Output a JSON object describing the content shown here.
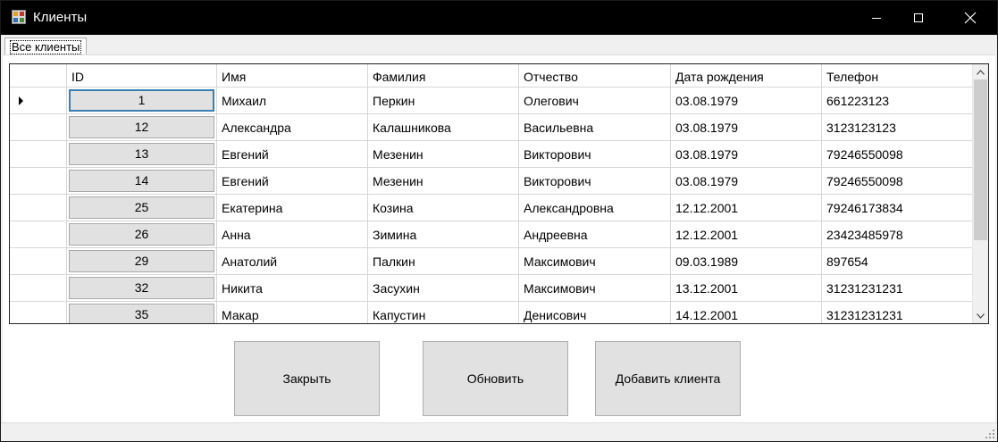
{
  "window": {
    "title": "Клиенты",
    "icon": "app-form-icon",
    "controls": [
      "minimize-icon",
      "maximize-icon",
      "close-icon"
    ]
  },
  "tab": {
    "label": "Все клиенты"
  },
  "table": {
    "columns": [
      "ID",
      "Имя",
      "Фамилия",
      "Отчество",
      "Дата рождения",
      "Телефон"
    ],
    "selected_row": 0,
    "rows": [
      {
        "id": "1",
        "first": "Михаил",
        "last": "Перкин",
        "middle": "Олегович",
        "birth": "03.08.1979",
        "phone": "661223123"
      },
      {
        "id": "12",
        "first": "Александра",
        "last": "Калашникова",
        "middle": "Васильевна",
        "birth": "03.08.1979",
        "phone": "3123123123"
      },
      {
        "id": "13",
        "first": "Евгений",
        "last": "Мезенин",
        "middle": "Викторович",
        "birth": "03.08.1979",
        "phone": "79246550098"
      },
      {
        "id": "14",
        "first": "Евгений",
        "last": "Мезенин",
        "middle": "Викторович",
        "birth": "03.08.1979",
        "phone": "79246550098"
      },
      {
        "id": "25",
        "first": "Екатерина",
        "last": "Козина",
        "middle": "Александровна",
        "birth": "12.12.2001",
        "phone": "79246173834"
      },
      {
        "id": "26",
        "first": "Анна",
        "last": "Зимина",
        "middle": "Андреевна",
        "birth": "12.12.2001",
        "phone": "23423485978"
      },
      {
        "id": "29",
        "first": "Анатолий",
        "last": "Палкин",
        "middle": "Максимович",
        "birth": "09.03.1989",
        "phone": "897654"
      },
      {
        "id": "32",
        "first": "Никита",
        "last": "Засухин",
        "middle": "Максимович",
        "birth": "13.12.2001",
        "phone": "31231231231"
      },
      {
        "id": "35",
        "first": "Макар",
        "last": "Капустин",
        "middle": "Денисович",
        "birth": "14.12.2001",
        "phone": "31231231231"
      }
    ]
  },
  "buttons": {
    "close": "Закрыть",
    "refresh": "Обновить",
    "add_client": "Добавить клиента"
  }
}
